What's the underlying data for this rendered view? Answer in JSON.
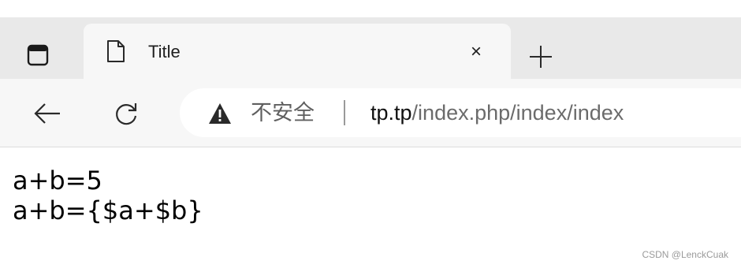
{
  "tab": {
    "title": "Title",
    "close_glyph": "×",
    "page_icon": "page-icon"
  },
  "tabstrip": {
    "tab_actions_icon": "tab-actions-icon",
    "new_tab_icon": "plus-icon"
  },
  "toolbar": {
    "back_icon": "arrow-left-icon",
    "refresh_icon": "refresh-icon"
  },
  "addressbar": {
    "security_icon": "warning-icon",
    "security_label": "不安全",
    "url_host": "tp.tp",
    "url_path": "/index.php/index/index"
  },
  "page": {
    "lines": [
      "a+b=5",
      "a+b={$a+$b}"
    ]
  },
  "watermark": "CSDN @LenckCuak"
}
